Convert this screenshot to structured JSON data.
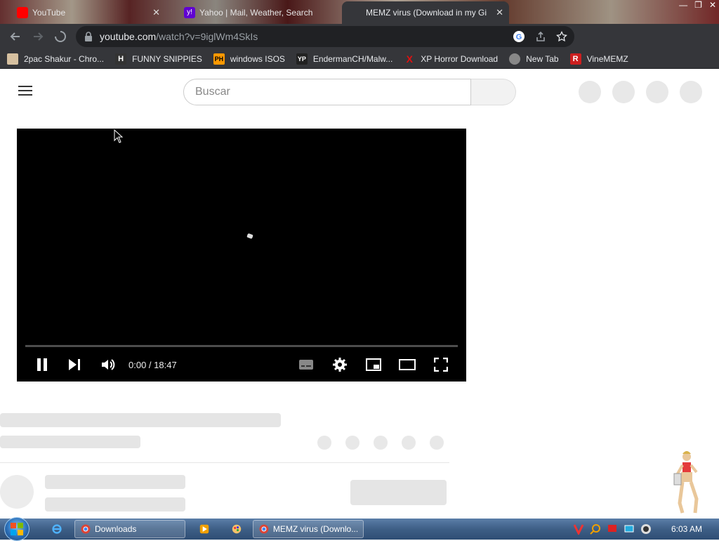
{
  "browser": {
    "tabs": [
      {
        "label": "YouTube",
        "favicon_color": "#ff0000",
        "active": false
      },
      {
        "label": "Yahoo | Mail, Weather, Search",
        "favicon_color": "#6001d2",
        "active": false
      },
      {
        "label": "MEMZ virus (Download in my Gi",
        "favicon_color": "#ff0000",
        "active": true
      }
    ],
    "url_host": "youtube.com",
    "url_path": "/watch?v=9iglWm4SkIs",
    "bookmarks": [
      {
        "label": "2pac Shakur - Chro...",
        "icon_color": "#e0e0e0",
        "icon_text": ""
      },
      {
        "label": "FUNNY SNIPPIES",
        "icon_color": "#333333",
        "icon_text": "H"
      },
      {
        "label": "windows ISOS",
        "icon_color": "#ff9900",
        "icon_text": "PH"
      },
      {
        "label": "EndermanCH/Malw...",
        "icon_color": "#222222",
        "icon_text": "YP"
      },
      {
        "label": "XP Horror Download",
        "icon_color": "#cc0000",
        "icon_text": "X"
      },
      {
        "label": "New Tab",
        "icon_color": "#888888",
        "icon_text": ""
      },
      {
        "label": "VineMEMZ",
        "icon_color": "#cc1f1f",
        "icon_text": "R"
      }
    ]
  },
  "page": {
    "search_placeholder": "Buscar",
    "player_time": "0:00 / 18:47",
    "progress_fraction": 0.0
  },
  "taskbar": {
    "items": [
      {
        "label": "Downloads",
        "open": true
      },
      {
        "label": "MEMZ virus (Downlo...",
        "open": true
      }
    ],
    "clock": "6:03 AM"
  },
  "colors": {
    "chrome_dark": "#35363a",
    "omnibox": "#202124",
    "skeleton": "#e5e5e5"
  }
}
